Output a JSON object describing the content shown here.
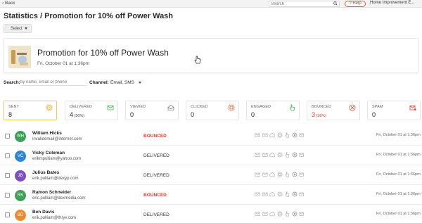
{
  "topbar": {
    "back_label": "Back",
    "search_placeholder": "Search",
    "help_label": "Help",
    "account_name": "Home Improvement E..."
  },
  "header": {
    "title": "Statistics / Promotion for 10% off Power Wash",
    "select_label": "Select"
  },
  "campaign": {
    "title": "Promotion for 10% off Power Wash",
    "date": "Fri, October 01 at 1:36pm"
  },
  "filters": {
    "search_label": "Search:",
    "search_placeholder": "by name, email or phone",
    "channel_label": "Channel:",
    "channel_value": "Email, SMS"
  },
  "stats": [
    {
      "label": "SENT",
      "value": "8",
      "pct": "",
      "icon": "target-icon"
    },
    {
      "label": "DELIVERED",
      "value": "4",
      "pct": "(50%)",
      "icon": "envelope-check-icon"
    },
    {
      "label": "VIEWED",
      "value": "0",
      "pct": "",
      "icon": "envelope-open-icon"
    },
    {
      "label": "CLICKED",
      "value": "0",
      "pct": "",
      "icon": "click-target-icon"
    },
    {
      "label": "ENGAGED",
      "value": "0",
      "pct": "",
      "icon": "hand-pointer-icon"
    },
    {
      "label": "BOUNCED",
      "value": "3",
      "pct": "(38%)",
      "icon": "circle-x-icon"
    },
    {
      "label": "SPAM",
      "value": "0",
      "pct": "",
      "icon": "envelope-alert-icon"
    }
  ],
  "contacts": [
    {
      "initials": "WH",
      "name": "William Hicks",
      "email": "invalidemail@internet.com",
      "status": "BOUNCED",
      "timestamp": "Fri, October 01 at 1:36pm",
      "color": "#3fa05a"
    },
    {
      "initials": "VC",
      "name": "Vicky Coleman",
      "email": "erikmpulliam@yahoo.com",
      "status": "DELIVERED",
      "timestamp": "Fri, October 01 at 1:36pm",
      "color": "#2e86d4"
    },
    {
      "initials": "JB",
      "name": "Julius Bates",
      "email": "erik.pulliam@dexyp.com",
      "status": "DELIVERED",
      "timestamp": "Fri, October 01 at 1:36pm",
      "color": "#7c4dc4"
    },
    {
      "initials": "RS",
      "name": "Ramon Schneider",
      "email": "eric.pulliam@dexmedia.com",
      "status": "BOUNCED",
      "timestamp": "Fri, October 01 at 1:36pm",
      "color": "#3fa05a"
    },
    {
      "initials": "BD",
      "name": "Ben Davis",
      "email": "erik.pulliam@thryv.com",
      "status": "DELIVERED",
      "timestamp": "Fri, October 01 at 1:36pm",
      "color": "#ef8a2b"
    }
  ],
  "colors": {
    "accent_red": "#d9432f",
    "active_card_border": "#f0c46a"
  }
}
